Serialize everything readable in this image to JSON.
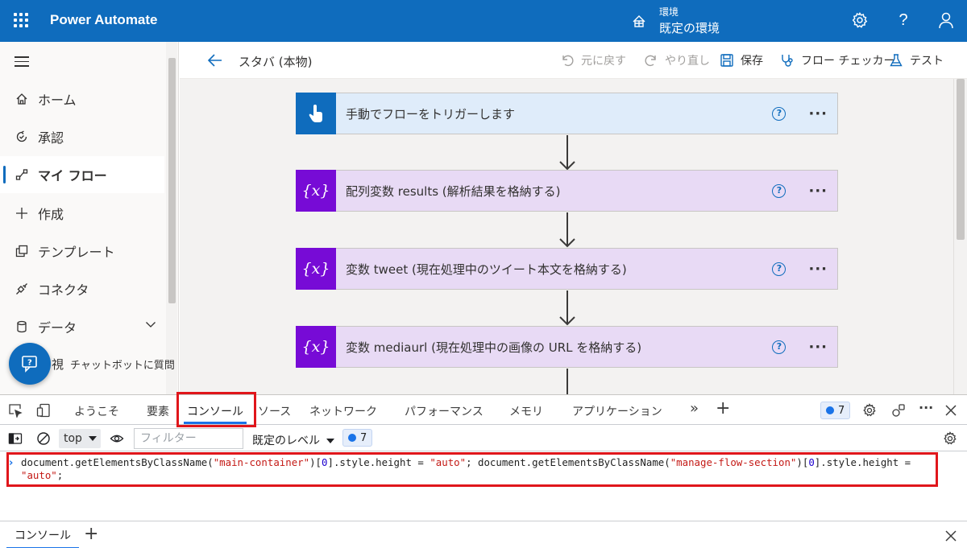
{
  "header": {
    "app_title": "Power Automate",
    "environment_label": "環境",
    "environment_name": "既定の環境",
    "icons": [
      "waffle-icon",
      "environment-icon",
      "settings-icon",
      "help-icon",
      "account-icon"
    ]
  },
  "colors": {
    "brand_blue": "#0f6cbd",
    "variable_purple": "#770bd6",
    "variable_bg": "#e8daf5",
    "trigger_bg": "#dfecfa",
    "highlight_red": "#e0161b"
  },
  "sidebar": {
    "items": [
      {
        "label": "ホーム",
        "icon": "home-icon"
      },
      {
        "label": "承認",
        "icon": "approvals-icon"
      },
      {
        "label": "マイ フロー",
        "icon": "my-flows-icon",
        "active": true
      },
      {
        "label": "作成",
        "icon": "plus-icon"
      },
      {
        "label": "テンプレート",
        "icon": "templates-icon"
      },
      {
        "label": "コネクタ",
        "icon": "connector-icon"
      },
      {
        "label": "データ",
        "icon": "database-icon"
      }
    ],
    "partial_label": "視",
    "chatbot_label": "チャットボットに質問"
  },
  "command_bar": {
    "flow_title": "スタバ (本物)",
    "undo": "元に戻す",
    "redo": "やり直し",
    "save": "保存",
    "flow_checker": "フロー チェッカー",
    "test": "テスト"
  },
  "flow": {
    "steps": [
      {
        "title": "手動でフローをトリガーします",
        "kind": "trigger",
        "icon": "touch-icon"
      },
      {
        "title": "配列変数 results (解析結果を格納する)",
        "kind": "variable",
        "icon": "variable-icon"
      },
      {
        "title": "変数 tweet (現在処理中のツイート本文を格納する)",
        "kind": "variable",
        "icon": "variable-icon"
      },
      {
        "title": "変数 mediaurl (現在処理中の画像の URL を格納する)",
        "kind": "variable",
        "icon": "variable-icon"
      }
    ],
    "help_glyph": "?",
    "more_glyph": "···",
    "variable_glyph": "{x}"
  },
  "devtools": {
    "tabs": [
      "ようこそ",
      "要素",
      "コンソール",
      "ソース",
      "ネットワーク",
      "パフォーマンス",
      "メモリ",
      "アプリケーション"
    ],
    "active_tab": "コンソール",
    "more_tabs": "»",
    "issues_count": "7",
    "context": "top",
    "filter_placeholder": "フィルター",
    "levels": "既定のレベル",
    "message_count": "7",
    "console_code": "document.getElementsByClassName(\"main-container\")[0].style.height = \"auto\"; document.getElementsByClassName(\"manage-flow-section\")[0].style.height = \"auto\";",
    "drawer_tab": "コンソール"
  }
}
